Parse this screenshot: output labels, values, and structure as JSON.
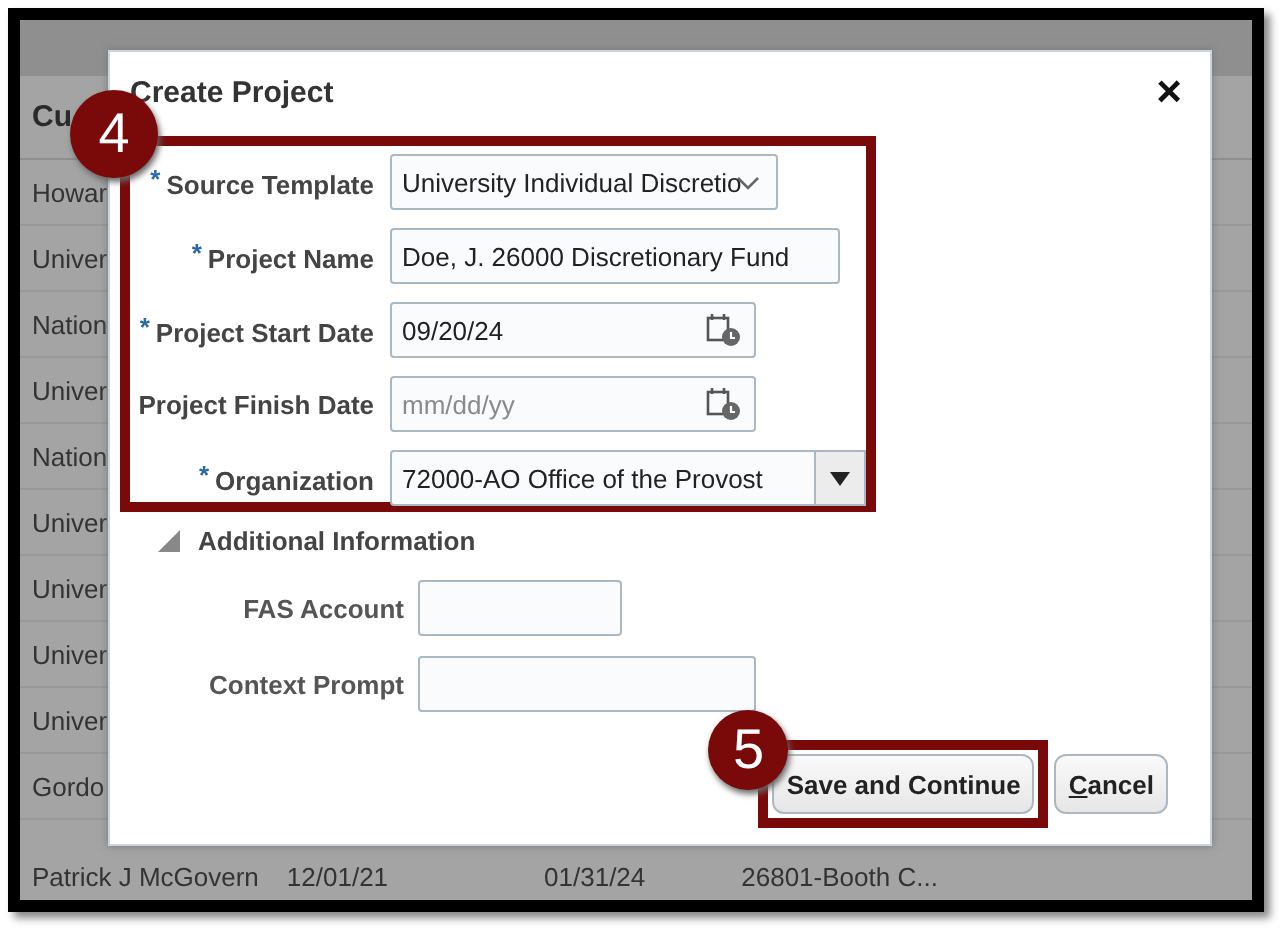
{
  "background_table": {
    "header": "Cu",
    "rows": [
      "Howar",
      "Univer",
      "Nation",
      "Univer",
      "Nation",
      "Univer",
      "Univer",
      "Univer",
      "Univer",
      "Gordo"
    ],
    "last_row": [
      "Patrick J McGovern",
      "12/01/21",
      "01/31/24",
      "26801-Booth C..."
    ]
  },
  "dialog": {
    "title": "Create Project",
    "close": "×",
    "required_mark": "*",
    "fields": [
      {
        "label": "Source Template",
        "required": true,
        "kind": "select",
        "value": "University Individual Discretio"
      },
      {
        "label": "Project Name",
        "required": true,
        "kind": "text",
        "value": "Doe, J. 26000 Discretionary Fund"
      },
      {
        "label": "Project Start Date",
        "required": true,
        "kind": "date",
        "value": "09/20/24"
      },
      {
        "label": "Project Finish Date",
        "required": false,
        "kind": "date",
        "placeholder": "mm/dd/yy"
      },
      {
        "label": "Organization",
        "required": true,
        "kind": "combo",
        "value": "72000-AO Office of the Provost"
      }
    ],
    "section": {
      "title": "Additional Information",
      "expanded": true,
      "fields": [
        {
          "label": "FAS Account",
          "kind": "short"
        },
        {
          "label": "Context Prompt",
          "kind": "medium"
        }
      ]
    },
    "save_button": "Save and Continue",
    "cancel_button": {
      "mnemonic": "C",
      "rest": "ancel"
    }
  },
  "callouts": [
    {
      "number": "4"
    },
    {
      "number": "5"
    }
  ]
}
